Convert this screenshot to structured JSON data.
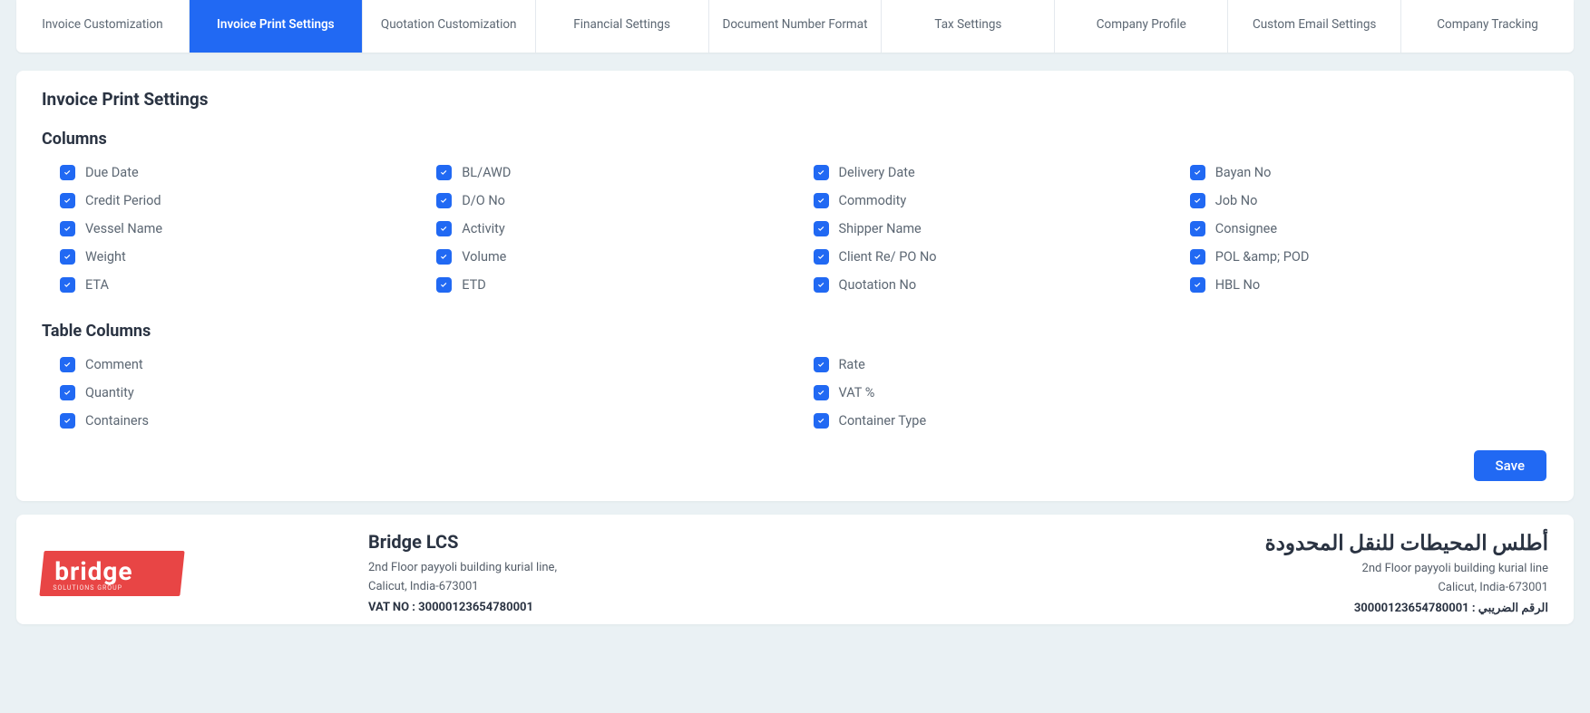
{
  "tabs": [
    {
      "label": "Invoice Customization",
      "active": false
    },
    {
      "label": "Invoice Print Settings",
      "active": true
    },
    {
      "label": "Quotation Customization",
      "active": false
    },
    {
      "label": "Financial Settings",
      "active": false
    },
    {
      "label": "Document Number Format",
      "active": false
    },
    {
      "label": "Tax Settings",
      "active": false
    },
    {
      "label": "Company Profile",
      "active": false
    },
    {
      "label": "Custom Email Settings",
      "active": false
    },
    {
      "label": "Company Tracking",
      "active": false
    }
  ],
  "page": {
    "title": "Invoice Print Settings"
  },
  "columns_section": {
    "title": "Columns",
    "items": [
      {
        "label": "Due Date",
        "checked": true
      },
      {
        "label": "BL/AWD",
        "checked": true
      },
      {
        "label": "Delivery Date",
        "checked": true
      },
      {
        "label": "Bayan No",
        "checked": true
      },
      {
        "label": "Credit Period",
        "checked": true
      },
      {
        "label": "D/O No",
        "checked": true
      },
      {
        "label": "Commodity",
        "checked": true
      },
      {
        "label": "Job No",
        "checked": true
      },
      {
        "label": "Vessel Name",
        "checked": true
      },
      {
        "label": "Activity",
        "checked": true
      },
      {
        "label": "Shipper Name",
        "checked": true
      },
      {
        "label": "Consignee",
        "checked": true
      },
      {
        "label": "Weight",
        "checked": true
      },
      {
        "label": "Volume",
        "checked": true
      },
      {
        "label": "Client Re/ PO No",
        "checked": true
      },
      {
        "label": "POL &amp; POD",
        "checked": true
      },
      {
        "label": "ETA",
        "checked": true
      },
      {
        "label": "ETD",
        "checked": true
      },
      {
        "label": "Quotation No",
        "checked": true
      },
      {
        "label": "HBL No",
        "checked": true
      }
    ]
  },
  "table_columns_section": {
    "title": "Table Columns",
    "items": [
      {
        "label": "Comment",
        "checked": true
      },
      {
        "label": "Rate",
        "checked": true
      },
      {
        "label": "Quantity",
        "checked": true
      },
      {
        "label": "VAT %",
        "checked": true
      },
      {
        "label": "Containers",
        "checked": true
      },
      {
        "label": "Container Type",
        "checked": true
      }
    ]
  },
  "buttons": {
    "save": "Save"
  },
  "preview": {
    "logo": {
      "brand": "bridge",
      "tagline": "SOLUTIONS GROUP"
    },
    "left": {
      "company_name": "Bridge LCS",
      "address_line1": "2nd Floor payyoli building kurial line,",
      "address_line2": "Calicut, India-673001",
      "vat_label_value": "VAT NO : 30000123654780001"
    },
    "right": {
      "company_name_ar": "أطلس المحيطات للنقل المحدودة",
      "address_line1": "2nd Floor payyoli building kurial line",
      "address_line2": "Calicut, India-673001",
      "vat_ar": "الرقم الضريبي : 30000123654780001"
    }
  }
}
